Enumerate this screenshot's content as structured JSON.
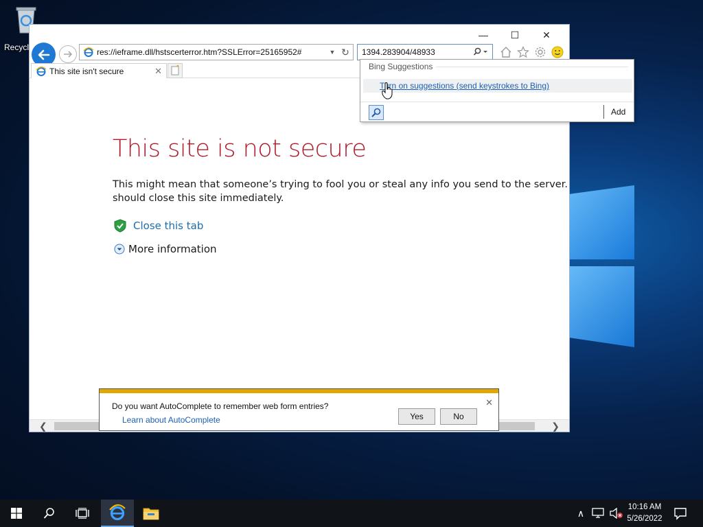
{
  "desktop": {
    "recycle_label": "Recycl"
  },
  "window": {
    "controls": {
      "minimize": "—",
      "maximize": "☐",
      "close": "✕"
    }
  },
  "address": {
    "url": "res://ieframe.dll/hstscerterror.htm?SSLError=25165952#",
    "dropdown_icon": "chevron-down-icon",
    "refresh_icon": "refresh-icon"
  },
  "search": {
    "value": "1394.283904/48933"
  },
  "toolbar": {
    "icons": [
      "home-icon",
      "favorites-star-icon",
      "settings-gear-icon",
      "feedback-smiley-icon"
    ]
  },
  "tab": {
    "title": "This site isn't secure",
    "close_glyph": "✕"
  },
  "page": {
    "title": "This site is not secure",
    "body": "This might mean that someone’s trying to fool you or steal any info you send to the server. You should close this site immediately.",
    "close_tab_link": "Close this tab",
    "more_info": "More information"
  },
  "scrollbar": {
    "left_arrow": "❮",
    "right_arrow": "❯"
  },
  "bing": {
    "header": "Bing Suggestions",
    "suggestion": "Turn on suggestions (send keystrokes to Bing)",
    "add_label": "Add"
  },
  "autocomplete": {
    "question": "Do you want AutoComplete to remember web form entries?",
    "learn_link": "Learn about AutoComplete",
    "yes_label": "Yes",
    "no_label": "No",
    "close_glyph": "✕"
  },
  "taskbar": {
    "time": "10:16 AM",
    "date": "5/26/2022",
    "tray_up_glyph": "∧"
  },
  "colors": {
    "error_title": "#b21a2a",
    "link": "#1d6cab",
    "ie_blue": "#1e78d4",
    "notify_bar": "#e0a800",
    "taskbar": "#101318"
  }
}
